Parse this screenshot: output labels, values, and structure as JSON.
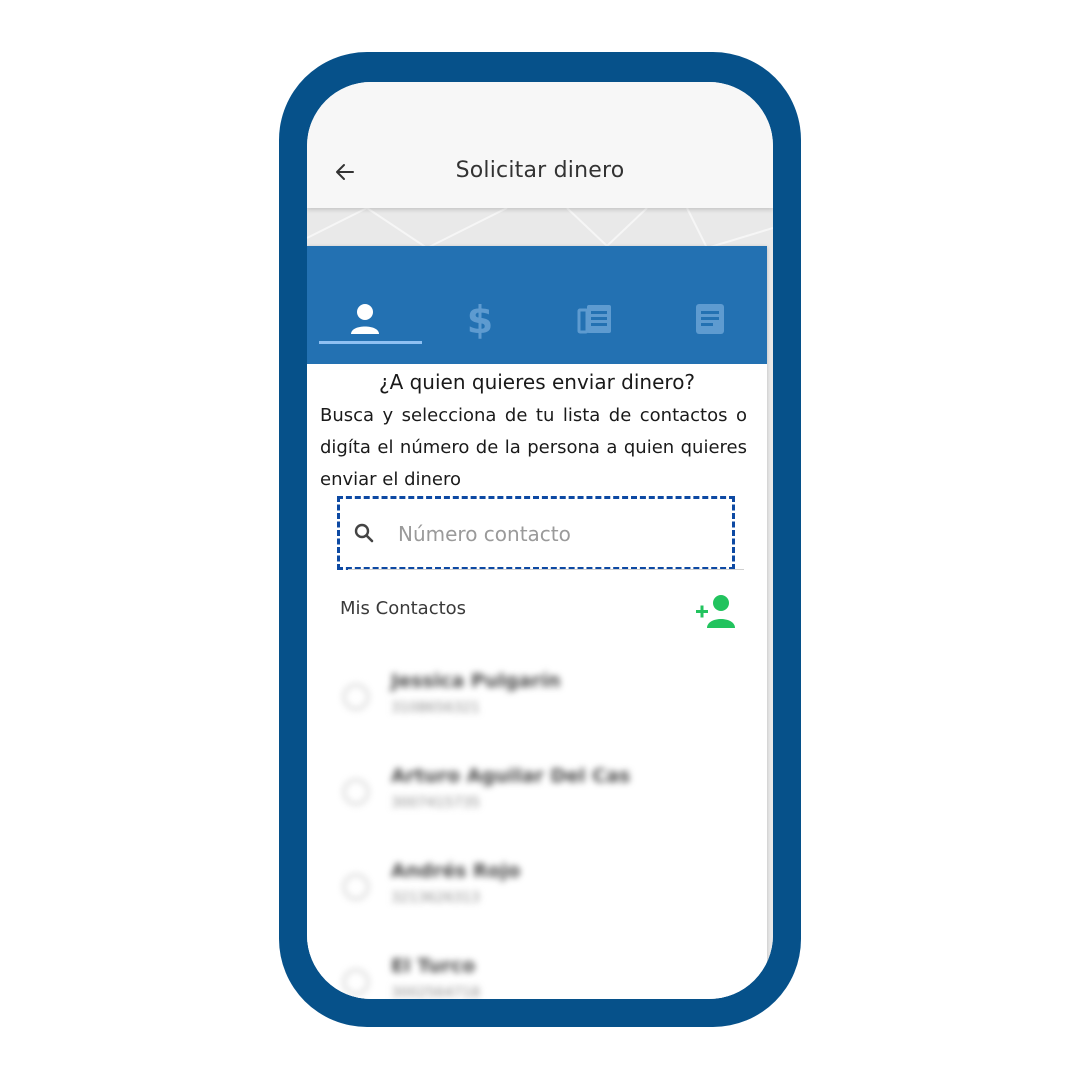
{
  "appbar": {
    "title": "Solicitar dinero",
    "back_icon": "arrow-left-icon"
  },
  "tabs": [
    {
      "icon": "person-icon",
      "active": true
    },
    {
      "icon": "dollar-icon",
      "active": false
    },
    {
      "icon": "receipt-icon",
      "active": false
    },
    {
      "icon": "document-icon",
      "active": false
    }
  ],
  "prompt": {
    "question": "¿A quien quieres enviar dinero?",
    "description": "Busca y selecciona de tu lista de contactos o digíta el número de la persona a quien quieres enviar el dinero"
  },
  "search": {
    "placeholder": "Número contacto",
    "value": ""
  },
  "contacts": {
    "header": "Mis Contactos",
    "add_icon": "add-person-icon",
    "items": [
      {
        "name": "Jessica Pulgarín",
        "phone": "3108656321"
      },
      {
        "name": "Arturo Aguilar Del Cas",
        "phone": "3007415735"
      },
      {
        "name": "Andrés Rojo",
        "phone": "3213626313"
      },
      {
        "name": "El Turco",
        "phone": "3002564718"
      }
    ]
  },
  "colors": {
    "frame": "#06518a",
    "tabbar": "#2371b2",
    "add_green": "#22c35e",
    "highlight": "#0d49a3"
  }
}
